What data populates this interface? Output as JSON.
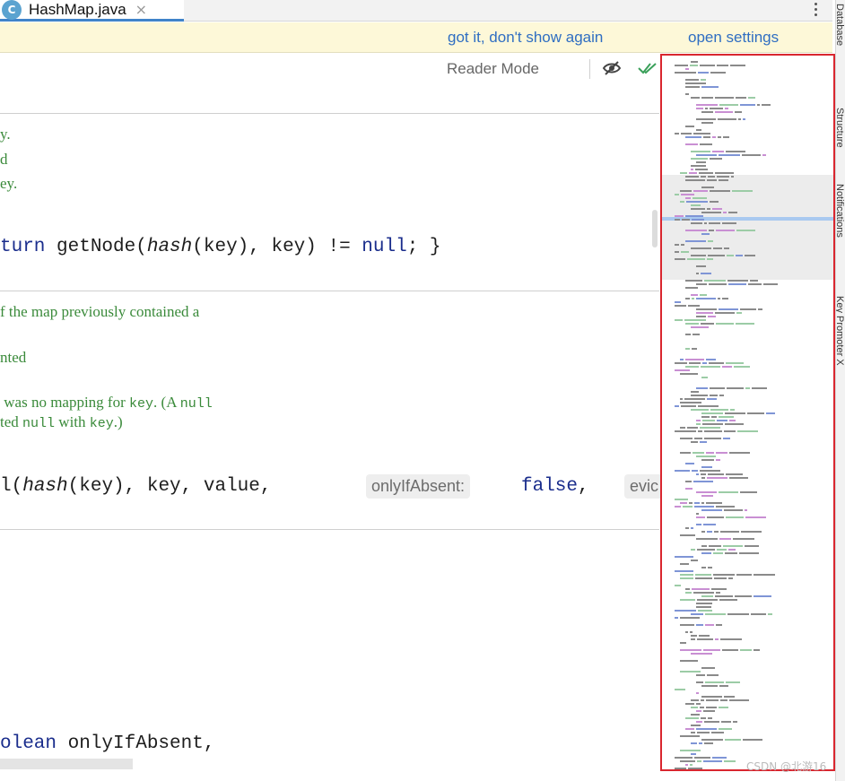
{
  "tab": {
    "icon_letter": "C",
    "file_name": "HashMap.java",
    "close_glyph": "×"
  },
  "banner": {
    "got_it": "got it, don't show again",
    "open_settings": "open settings"
  },
  "toolbar": {
    "reader_mode": "Reader Mode"
  },
  "doc_lines": [
    {
      "text": "y."
    },
    {
      "text": "d"
    },
    {
      "text": "ey."
    },
    {
      "text": "f the map previously contained a"
    },
    {
      "text": "nted"
    },
    {
      "pre": " was no mapping for ",
      "code1": "key",
      "mid": ". (A ",
      "code2": "null"
    },
    {
      "pre": "ted ",
      "code1": "null",
      "mid": " with ",
      "code2": "key",
      "post": ".)"
    }
  ],
  "code_lines": {
    "line1": {
      "kw": "turn",
      "t1": " getNode(",
      "it": "hash",
      "t2": "(key), key) != ",
      "kw2": "null",
      "t3": "; }"
    },
    "line2": {
      "t0": "l(",
      "it": "hash",
      "t1": "(key), key, value,",
      "hint1": "onlyIfAbsent:",
      "kw": "false",
      "t2": ",",
      "hint2": "evic"
    },
    "line3": {
      "kw": "olean",
      "t1": " onlyIfAbsent,"
    }
  },
  "colors": {
    "accent_tab": "#4083c9",
    "banner_bg": "#fdf8d8",
    "link": "#2f6ec2",
    "doc_green": "#3a8a3a",
    "keyword": "#1a2d8c",
    "minimap_border": "#d9262f"
  },
  "icons": {
    "more": "more-vertical-icon",
    "eye": "eye-slash-icon",
    "check": "double-check-icon"
  },
  "sidebar_tabs": [
    "Database",
    "Structure",
    "Notifications",
    "Key Promoter X"
  ],
  "watermark": "CSDN @北游16"
}
